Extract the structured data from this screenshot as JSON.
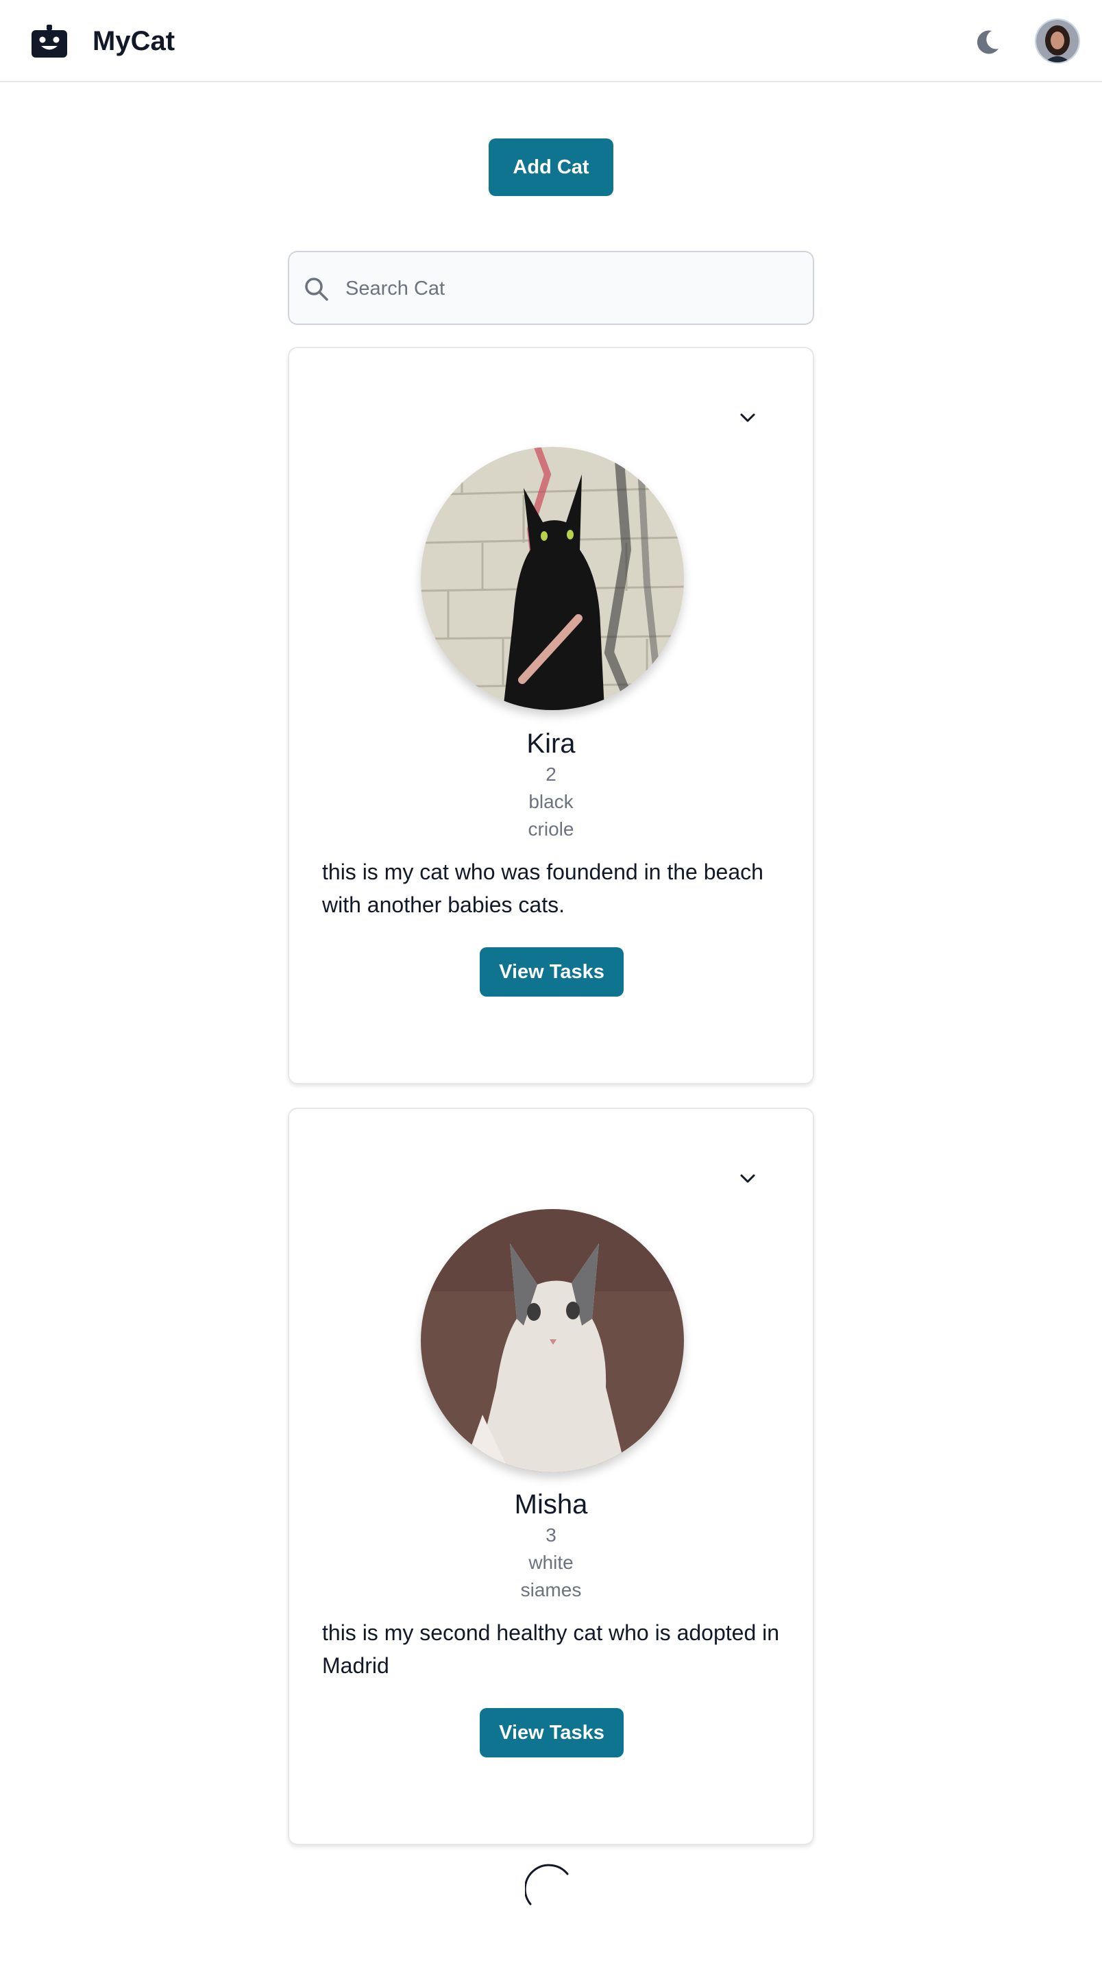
{
  "header": {
    "title": "MyCat",
    "logo_icon": "robot-face-icon",
    "theme_icon": "moon-icon",
    "avatar_icon": "user-avatar"
  },
  "actions": {
    "add_cat_label": "Add Cat"
  },
  "search": {
    "placeholder": "Search Cat",
    "value": "",
    "icon": "search-icon"
  },
  "cats": [
    {
      "name": "Kira",
      "age": "2",
      "color": "black",
      "breed": "criole",
      "description": "this is my cat who was foundend in the beach with another babies cats.",
      "button_label": "View Tasks"
    },
    {
      "name": "Misha",
      "age": "3",
      "color": "white",
      "breed": "siames",
      "description": "this is my second healthy cat who is adopted in Madrid",
      "button_label": "View Tasks"
    }
  ],
  "colors": {
    "primary": "#0e7490",
    "border": "#e5e7eb",
    "muted_text": "#6b7280"
  },
  "loading_indicator": "spinner-icon"
}
